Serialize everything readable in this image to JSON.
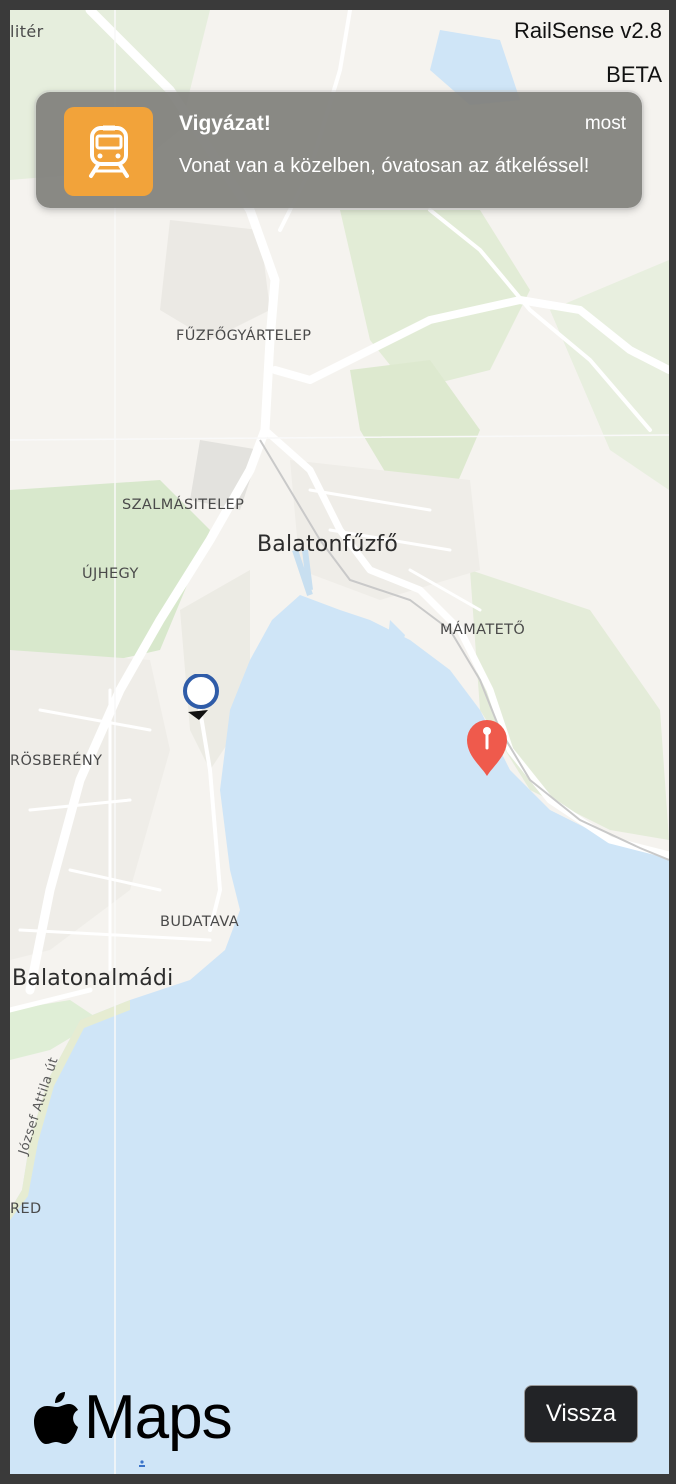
{
  "app": {
    "title": "RailSense v2.8",
    "tag": "BETA"
  },
  "notification": {
    "icon": "train-icon",
    "title": "Vigyázat!",
    "time": "most",
    "body": "Vonat van a közelben, óvatosan az átkeléssel!",
    "icon_color": "#f2a33a"
  },
  "map": {
    "labels": {
      "top_left_fragment": "litér",
      "fuzfogyartelep": "FŰZFŐGYÁRTELEP",
      "szalmasitelep": "SZALMÁSITELEP",
      "balatonfuzfo": "Balatonfűzfő",
      "ujhegy": "ÚJHEGY",
      "mamateto": "MÁMATETŐ",
      "rosbereny": "RÖSBERÉNY",
      "budatava": "BUDATAVA",
      "balatonalmadi": "Balatonalmádi",
      "jozsef_attila_ut": "József Attila út",
      "red_fragment": "RED"
    },
    "colors": {
      "water": "#cfe5f7",
      "land": "#f5f3ef",
      "green": "#e2ecd6",
      "road": "#ffffff",
      "pin": "#ef5a4c",
      "user": "#2f5ca8"
    },
    "markers": {
      "user_location_icon": "user-location-icon",
      "destination_icon": "map-pin-icon"
    }
  },
  "footer": {
    "logo_text": "Maps",
    "logo_icon": "apple-icon",
    "back_label": "Vissza"
  }
}
